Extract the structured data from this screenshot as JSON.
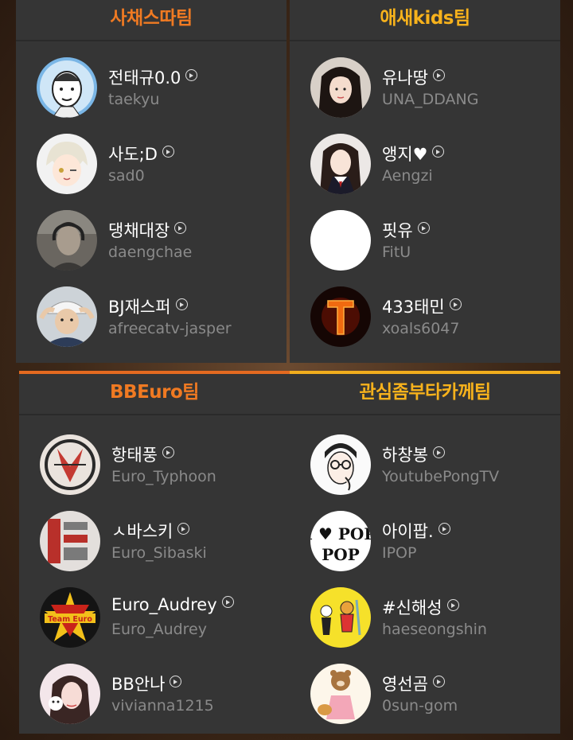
{
  "teams": [
    {
      "title": "사채스따팀",
      "title_color": "#f07a22",
      "members": [
        {
          "name": "전태규0.0",
          "handle": "taekyu",
          "avatar": "cartoon-man-avatar"
        },
        {
          "name": "사도;D",
          "handle": "sad0",
          "avatar": "anime-boy-avatar"
        },
        {
          "name": "댕채대장",
          "handle": "daengchae",
          "avatar": "photo-man-headset-avatar"
        },
        {
          "name": "BJ재스퍼",
          "handle": "afreecatv-jasper",
          "avatar": "photo-man-cap-avatar"
        }
      ]
    },
    {
      "title": "애새kids팀",
      "title_color": "#f7b21c",
      "members": [
        {
          "name": "유나땅",
          "handle": "UNA_DDANG",
          "avatar": "photo-girl-avatar"
        },
        {
          "name": "앵지♥",
          "handle": "Aengzi",
          "avatar": "photo-girl-uniform-avatar"
        },
        {
          "name": "핏유",
          "handle": "FitU",
          "avatar": "blank-white-avatar"
        },
        {
          "name": "433태민",
          "handle": "xoals6047",
          "avatar": "fire-letter-t-avatar"
        }
      ]
    },
    {
      "title": "BBEuro팀",
      "title_color": "#f07a22",
      "members": [
        {
          "name": "항태풍",
          "handle": "Euro_Typhoon",
          "avatar": "emblem-logo-avatar"
        },
        {
          "name": "ㅅ바스키",
          "handle": "Euro_Sibaski",
          "avatar": "korean-text-logo-avatar"
        },
        {
          "name": "Euro_Audrey",
          "handle": "Euro_Audrey",
          "avatar": "team-euro-logo-avatar",
          "logo_text": "Team Euro"
        },
        {
          "name": "BB안나",
          "handle": "vivianna1215",
          "avatar": "photo-girl-avatar"
        }
      ]
    },
    {
      "title": "관심좀부타카께팀",
      "title_color": "#f7b21c",
      "members": [
        {
          "name": "하창봉",
          "handle": "YoutubePongTV",
          "avatar": "cartoon-glasses-avatar"
        },
        {
          "name": "아이팝.",
          "handle": "IPOP",
          "avatar": "i-love-pop-avatar",
          "logo_text": "I ♥ POP"
        },
        {
          "name": "#신해성",
          "handle": "haeseongshin",
          "avatar": "yellow-cartoon-avatar"
        },
        {
          "name": "영선곰",
          "handle": "0sun-gom",
          "avatar": "bear-cartoon-avatar"
        }
      ]
    }
  ]
}
